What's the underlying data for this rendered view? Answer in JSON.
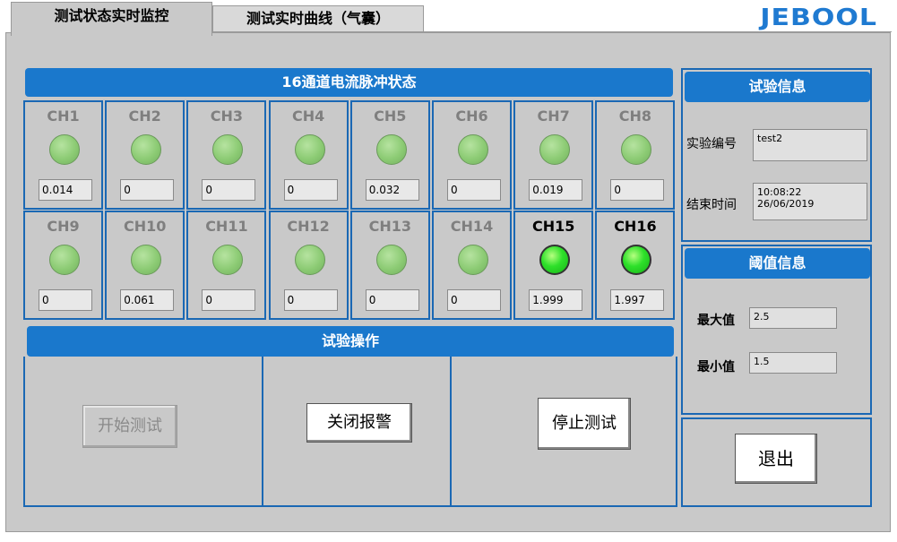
{
  "tabs": [
    {
      "label": "测试状态实时监控",
      "active": true
    },
    {
      "label": "测试实时曲线（气囊）",
      "active": false
    }
  ],
  "logo": "JEBOOL",
  "channel_panel": {
    "title": "16通道电流脉冲状态",
    "channels": [
      {
        "label": "CH1",
        "value": "0.014",
        "on": false
      },
      {
        "label": "CH2",
        "value": "0",
        "on": false
      },
      {
        "label": "CH3",
        "value": "0",
        "on": false
      },
      {
        "label": "CH4",
        "value": "0",
        "on": false
      },
      {
        "label": "CH5",
        "value": "0.032",
        "on": false
      },
      {
        "label": "CH6",
        "value": "0",
        "on": false
      },
      {
        "label": "CH7",
        "value": "0.019",
        "on": false
      },
      {
        "label": "CH8",
        "value": "0",
        "on": false
      },
      {
        "label": "CH9",
        "value": "0",
        "on": false
      },
      {
        "label": "CH10",
        "value": "0.061",
        "on": false
      },
      {
        "label": "CH11",
        "value": "0",
        "on": false
      },
      {
        "label": "CH12",
        "value": "0",
        "on": false
      },
      {
        "label": "CH13",
        "value": "0",
        "on": false
      },
      {
        "label": "CH14",
        "value": "0",
        "on": false
      },
      {
        "label": "CH15",
        "value": "1.999",
        "on": true
      },
      {
        "label": "CH16",
        "value": "1.997",
        "on": true
      }
    ]
  },
  "operations": {
    "title": "试验操作",
    "start_label": "开始测试",
    "alarm_off_label": "关闭报警",
    "stop_label": "停止测试"
  },
  "test_info": {
    "title": "试验信息",
    "id_label": "实验编号",
    "id_value": "test2",
    "end_time_label": "结束时间",
    "end_time": "10:08:22",
    "end_date": "26/06/2019"
  },
  "threshold": {
    "title": "阈值信息",
    "max_label": "最大值",
    "max_value": "2.5",
    "min_label": "最小值",
    "min_value": "1.5"
  },
  "exit_label": "退出",
  "colors": {
    "accent": "#1a78cc",
    "panel": "#c9c9c9",
    "led_on": "#2ee02a",
    "led_off": "#8ccb74"
  }
}
